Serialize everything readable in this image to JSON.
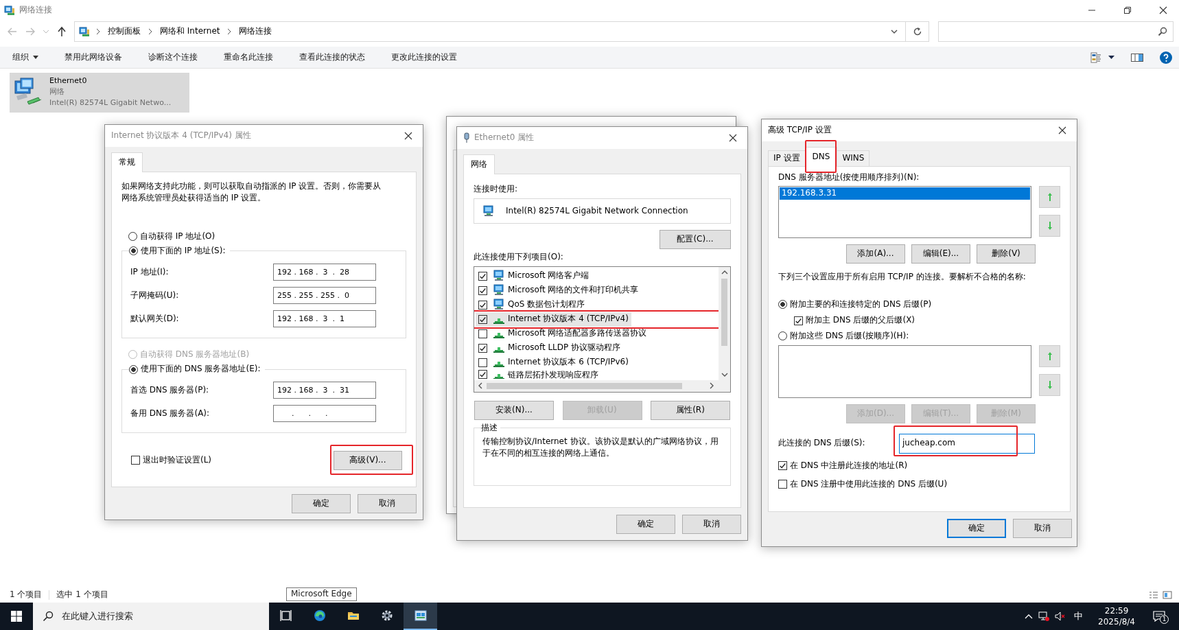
{
  "window": {
    "title": "网络连接",
    "breadcrumb": [
      "控制面板",
      "网络和 Internet",
      "网络连接"
    ]
  },
  "toolbar": {
    "items": [
      {
        "label": "组织",
        "kind": "menu"
      },
      {
        "label": "禁用此网络设备",
        "kind": "command"
      },
      {
        "label": "诊断这个连接",
        "kind": "command"
      },
      {
        "label": "重命名此连接",
        "kind": "command"
      },
      {
        "label": "查看此连接的状态",
        "kind": "command"
      },
      {
        "label": "更改此连接的设置",
        "kind": "command"
      }
    ]
  },
  "connections": [
    {
      "name": "Ethernet0",
      "network": "网络",
      "adapter": "Intel(R) 82574L Gigabit Netwo...",
      "selected": true
    }
  ],
  "status_bar": {
    "count": "1 个项目",
    "selection": "选中 1 个项目"
  },
  "ipv4_dialog": {
    "title": "Internet 协议版本 4 (TCP/IPv4) 属性",
    "tabs": [
      {
        "label": "常规",
        "selected": true
      }
    ],
    "intro": "如果网络支持此功能，则可以获取自动指派的 IP 设置。否则，你需要从网络系统管理员处获得适当的 IP 设置。",
    "ip_options": [
      {
        "label": "自动获得 IP 地址(O)",
        "selected": false,
        "disabled": false
      },
      {
        "label": "使用下面的 IP 地址(S):",
        "selected": true,
        "disabled": false
      }
    ],
    "ip_fields": [
      {
        "label": "IP 地址(I):",
        "value": "192 . 168 .  3  .  28"
      },
      {
        "label": "子网掩码(U):",
        "value": "255 . 255 . 255 .  0"
      },
      {
        "label": "默认网关(D):",
        "value": "192 . 168 .  3  .  1"
      }
    ],
    "dns_options": [
      {
        "label": "自动获得 DNS 服务器地址(B)",
        "selected": false,
        "disabled": true
      },
      {
        "label": "使用下面的 DNS 服务器地址(E):",
        "selected": true,
        "disabled": false
      }
    ],
    "dns_fields": [
      {
        "label": "首选 DNS 服务器(P):",
        "value": "192 . 168 .  3  .  31"
      },
      {
        "label": "备用 DNS 服务器(A):",
        "value": "      .      .      ."
      }
    ],
    "validate_on_exit": {
      "label": "退出时验证设置(L)",
      "checked": false
    },
    "advanced_button": {
      "label": "高级(V)...",
      "highlighted": true
    },
    "buttons": [
      {
        "label": "确定"
      },
      {
        "label": "取消"
      }
    ]
  },
  "properties_dialog": {
    "title": "Ethernet0 属性",
    "tabs": [
      {
        "label": "网络",
        "selected": true
      }
    ],
    "connect_using_label": "连接时使用:",
    "adapter": "Intel(R) 82574L Gigabit Network Connection",
    "configure_button": "配置(C)...",
    "items_label": "此连接使用下列项目(O):",
    "items": [
      {
        "label": "Microsoft 网络客户端",
        "kind": "client",
        "checked": true,
        "selected": false,
        "highlighted": false
      },
      {
        "label": "Microsoft 网络的文件和打印机共享",
        "kind": "service",
        "checked": true,
        "selected": false,
        "highlighted": false
      },
      {
        "label": "QoS 数据包计划程序",
        "kind": "service",
        "checked": true,
        "selected": false,
        "highlighted": false
      },
      {
        "label": "Internet 协议版本 4 (TCP/IPv4)",
        "kind": "protocol",
        "checked": true,
        "selected": true,
        "highlighted": true
      },
      {
        "label": "Microsoft 网络适配器多路传送器协议",
        "kind": "protocol",
        "checked": false,
        "selected": false,
        "highlighted": false
      },
      {
        "label": "Microsoft LLDP 协议驱动程序",
        "kind": "protocol",
        "checked": true,
        "selected": false,
        "highlighted": false
      },
      {
        "label": "Internet 协议版本 6 (TCP/IPv6)",
        "kind": "protocol",
        "checked": false,
        "selected": false,
        "highlighted": false
      },
      {
        "label": "链路层拓扑发现响应程序",
        "kind": "protocol",
        "checked": true,
        "selected": false,
        "highlighted": false
      }
    ],
    "item_buttons": [
      {
        "label": "安装(N)...",
        "disabled": false
      },
      {
        "label": "卸载(U)",
        "disabled": true
      },
      {
        "label": "属性(R)",
        "disabled": false
      }
    ],
    "description_label": "描述",
    "description": "传输控制协议/Internet 协议。该协议是默认的广域网络协议，用于在不同的相互连接的网络上通信。",
    "buttons": [
      {
        "label": "确定"
      },
      {
        "label": "取消"
      }
    ]
  },
  "advanced_dialog": {
    "title": "高级 TCP/IP 设置",
    "tabs": [
      {
        "label": "IP 设置",
        "selected": false,
        "highlighted": false
      },
      {
        "label": "DNS",
        "selected": true,
        "highlighted": true
      },
      {
        "label": "WINS",
        "selected": false,
        "highlighted": false
      }
    ],
    "servers_label": "DNS 服务器地址(按使用顺序排列)(N):",
    "servers": [
      {
        "value": "192.168.3.31",
        "selected": true
      }
    ],
    "server_buttons": [
      {
        "label": "添加(A)...",
        "disabled": false
      },
      {
        "label": "编辑(E)...",
        "disabled": false
      },
      {
        "label": "删除(V)",
        "disabled": false
      }
    ],
    "note": "下列三个设置应用于所有启用 TCP/IP 的连接。要解析不合格的名称:",
    "append_primary": {
      "label": "附加主要的和连接特定的 DNS 后缀(P)",
      "selected": true
    },
    "append_parent": {
      "label": "附加主 DNS 后缀的父后缀(X)",
      "checked": true
    },
    "append_these": {
      "label": "附加这些 DNS 后缀(按顺序)(H):",
      "selected": false
    },
    "suffix_buttons": [
      {
        "label": "添加(D)...",
        "disabled": true
      },
      {
        "label": "编辑(T)...",
        "disabled": true
      },
      {
        "label": "删除(M)",
        "disabled": true
      }
    ],
    "suffix_label": "此连接的 DNS 后缀(S):",
    "suffix": {
      "value": "jucheap.com",
      "highlighted": true
    },
    "register_options": [
      {
        "label": "在 DNS 中注册此连接的地址(R)",
        "checked": true
      },
      {
        "label": "在 DNS 注册中使用此连接的 DNS 后缀(U)",
        "checked": false
      }
    ],
    "buttons": [
      {
        "label": "确定",
        "default": true
      },
      {
        "label": "取消",
        "default": false
      }
    ]
  },
  "tooltip": "Microsoft Edge",
  "taskbar": {
    "search_placeholder": "在此键入进行搜索",
    "apps": [
      {
        "kind": "task_view",
        "active": false
      },
      {
        "kind": "browser",
        "active": false
      },
      {
        "kind": "folder",
        "active": false
      },
      {
        "kind": "settings",
        "active": false
      },
      {
        "kind": "network",
        "active": true
      }
    ],
    "ime": "中",
    "time": "22:59",
    "date": "2025/8/4",
    "notifications": "1"
  }
}
